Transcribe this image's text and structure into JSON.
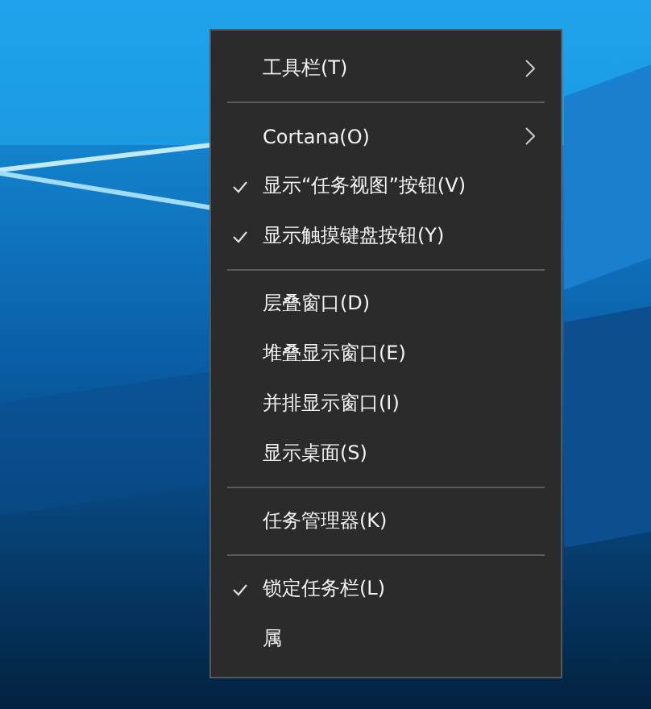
{
  "menu": {
    "items": [
      {
        "kind": "item",
        "label": "工具栏(T)",
        "checked": false,
        "has_submenu": true
      },
      {
        "kind": "separator"
      },
      {
        "kind": "item",
        "label": "Cortana(O)",
        "checked": false,
        "has_submenu": true
      },
      {
        "kind": "item",
        "label": "显示“任务视图”按钮(V)",
        "checked": true,
        "has_submenu": false
      },
      {
        "kind": "item",
        "label": "显示触摸键盘按钮(Y)",
        "checked": true,
        "has_submenu": false
      },
      {
        "kind": "separator"
      },
      {
        "kind": "item",
        "label": "层叠窗口(D)",
        "checked": false,
        "has_submenu": false
      },
      {
        "kind": "item",
        "label": "堆叠显示窗口(E)",
        "checked": false,
        "has_submenu": false
      },
      {
        "kind": "item",
        "label": "并排显示窗口(I)",
        "checked": false,
        "has_submenu": false
      },
      {
        "kind": "item",
        "label": "显示桌面(S)",
        "checked": false,
        "has_submenu": false
      },
      {
        "kind": "separator"
      },
      {
        "kind": "item",
        "label": "任务管理器(K)",
        "checked": false,
        "has_submenu": false
      },
      {
        "kind": "separator"
      },
      {
        "kind": "item",
        "label": "锁定任务栏(L)",
        "checked": true,
        "has_submenu": false
      },
      {
        "kind": "item",
        "label": "属",
        "checked": false,
        "has_submenu": false
      }
    ]
  }
}
